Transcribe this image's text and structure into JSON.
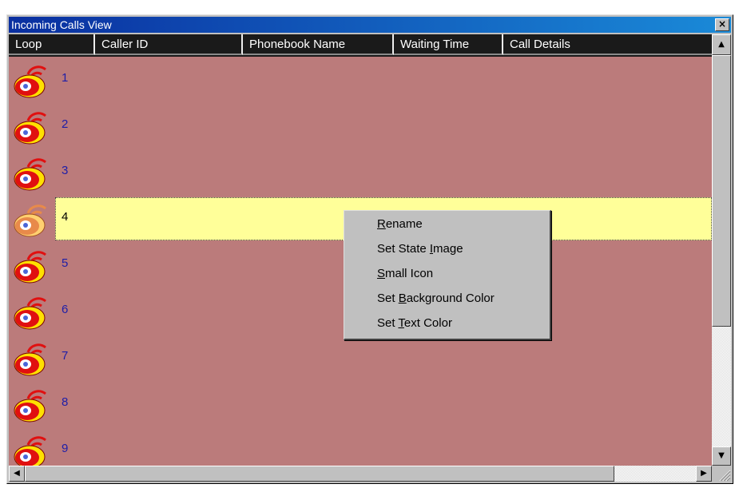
{
  "window": {
    "title": "Incoming Calls View",
    "close_glyph": "×"
  },
  "columns": [
    {
      "label": "Loop"
    },
    {
      "label": "Caller ID"
    },
    {
      "label": "Phonebook Name"
    },
    {
      "label": "Waiting Time"
    },
    {
      "label": "Call Details"
    }
  ],
  "rows": [
    {
      "label": "1",
      "icon": "phone-ringing-icon",
      "selected": false
    },
    {
      "label": "2",
      "icon": "phone-ringing-icon",
      "selected": false
    },
    {
      "label": "3",
      "icon": "phone-ringing-icon",
      "selected": false
    },
    {
      "label": "4",
      "icon": "phone-ringing-icon",
      "selected": true
    },
    {
      "label": "5",
      "icon": "phone-ringing-icon",
      "selected": false
    },
    {
      "label": "6",
      "icon": "phone-ringing-icon",
      "selected": false
    },
    {
      "label": "7",
      "icon": "phone-ringing-icon",
      "selected": false
    },
    {
      "label": "8",
      "icon": "phone-ringing-icon",
      "selected": false
    },
    {
      "label": "9",
      "icon": "phone-ringing-icon",
      "selected": false
    }
  ],
  "context_menu": {
    "items": [
      {
        "label": "Rename",
        "accel": "R"
      },
      {
        "label": "Set State Image",
        "accel": "I"
      },
      {
        "label": "Small Icon",
        "accel": "S"
      },
      {
        "label": "Set Background Color",
        "accel": "B"
      },
      {
        "label": "Set Text Color",
        "accel": "T"
      }
    ]
  },
  "colors": {
    "list_background": "#bb7b7b",
    "selected_row": "#ffff99",
    "header_background": "#1a1a1a",
    "row_text": "#1e1ea8",
    "titlebar_start": "#0a2fa0",
    "titlebar_end": "#1a8ad8"
  }
}
